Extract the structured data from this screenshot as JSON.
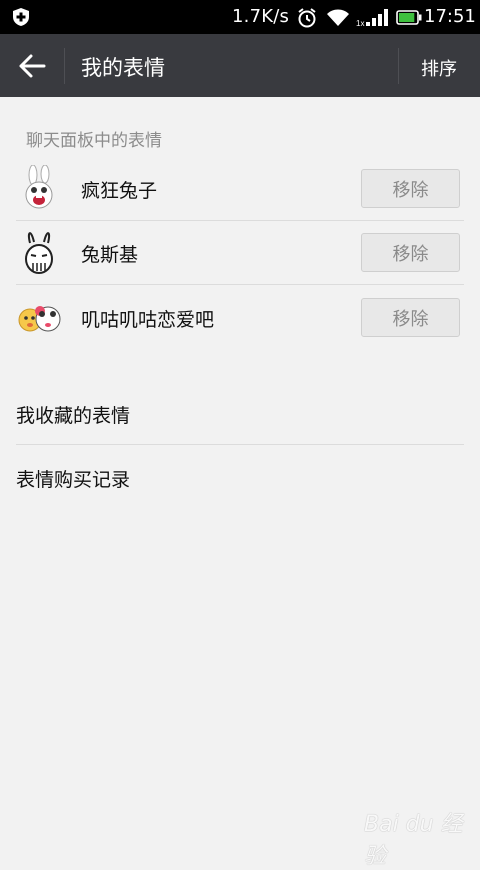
{
  "status_bar": {
    "net_speed": "1.7K/s",
    "time": "17:51",
    "battery_level": 0.9,
    "icons": [
      "shield-icon",
      "alarm-icon",
      "wifi-icon",
      "signal-icon",
      "battery-icon"
    ]
  },
  "header": {
    "title": "我的表情",
    "sort_label": "排序",
    "background": "#393a3f"
  },
  "section": {
    "label": "聊天面板中的表情"
  },
  "stickers": [
    {
      "name": "疯狂兔子",
      "action": "移除",
      "icon": "crazy-rabbit-icon"
    },
    {
      "name": "兔斯基",
      "action": "移除",
      "icon": "tuzki-icon"
    },
    {
      "name": "叽咕叽咕恋爱吧",
      "action": "移除",
      "icon": "love-couple-icon"
    }
  ],
  "links": {
    "favorites": "我收藏的表情",
    "purchase_history": "表情购买记录"
  },
  "watermark": "Bai du 经验"
}
